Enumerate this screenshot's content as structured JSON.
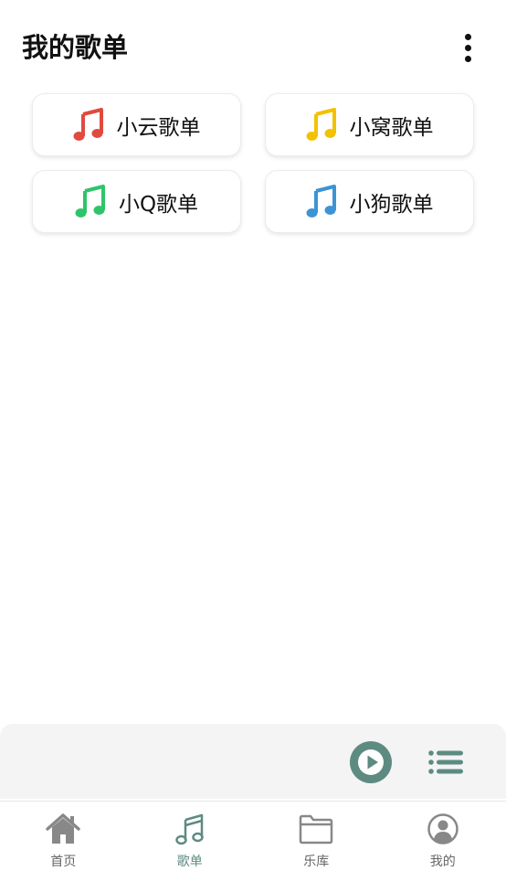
{
  "header": {
    "title": "我的歌单"
  },
  "playlists": [
    {
      "label": "小云歌单",
      "icon": "music-note-icon",
      "color": "#e04a3f"
    },
    {
      "label": "小窝歌单",
      "icon": "music-note-icon",
      "color": "#f2c200"
    },
    {
      "label": "小Q歌单",
      "icon": "music-note-icon",
      "color": "#2fc46a"
    },
    {
      "label": "小狗歌单",
      "icon": "music-note-icon",
      "color": "#3d94d4"
    }
  ],
  "player": {
    "play_icon": "play-icon",
    "queue_icon": "playlist-queue-icon",
    "accent": "#5d8b81"
  },
  "tabs": [
    {
      "label": "首页",
      "icon": "home-icon",
      "active": false
    },
    {
      "label": "歌单",
      "icon": "music-note-icon",
      "active": true
    },
    {
      "label": "乐库",
      "icon": "folder-icon",
      "active": false
    },
    {
      "label": "我的",
      "icon": "user-icon",
      "active": false
    }
  ],
  "colors": {
    "accent": "#5d8b81",
    "inactive": "#888888"
  }
}
